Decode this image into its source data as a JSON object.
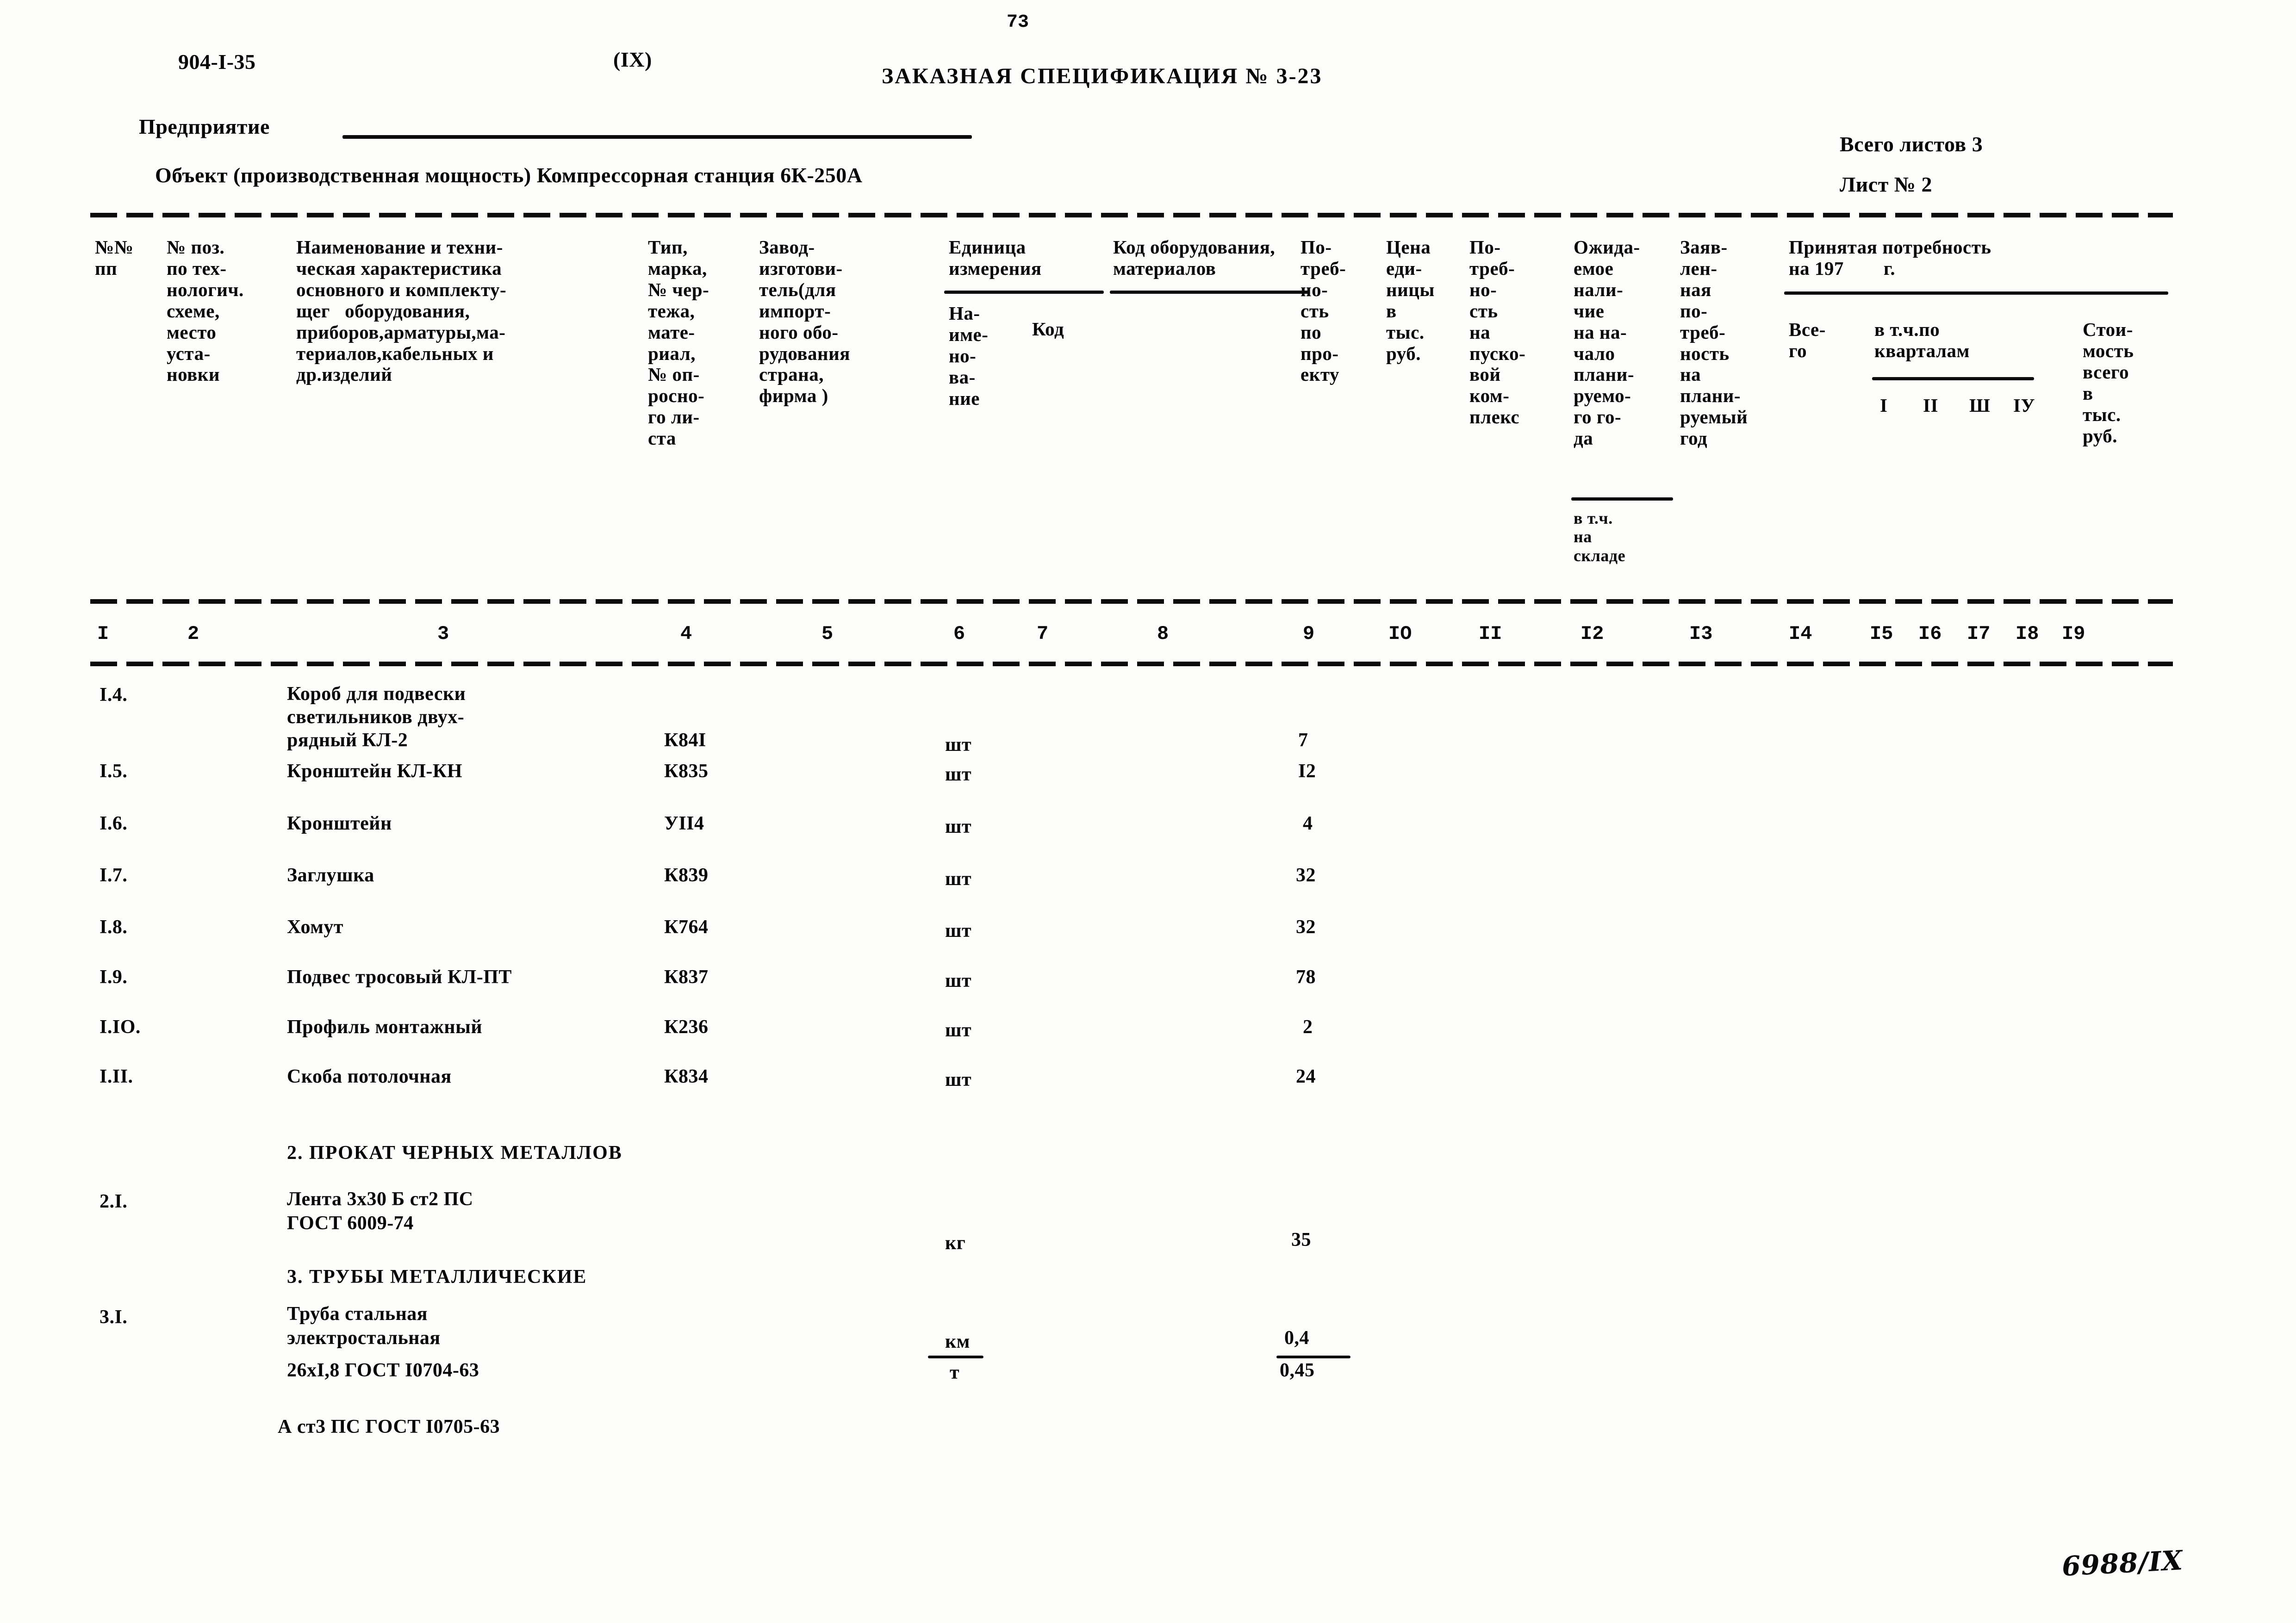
{
  "page": {
    "page_number": "73",
    "doc_code": "904-I-35",
    "section_mark": "(IX)",
    "title": "ЗАКАЗНАЯ СПЕЦИФИКАЦИЯ № 3-23",
    "enterprise_label": "Предприятие",
    "object_line": "Объект (производственная мощность) Компрессорная станция 6К-250А",
    "total_sheets": "Всего листов 3",
    "sheet_no": "Лист № 2",
    "archive_mark": "6988/IX"
  },
  "headers": {
    "col1": "№№\nпп",
    "col2": "№ поз.\nпо тех-\nнологич.\nсхеме,\nместо\nуста-\nновки",
    "col3": "Наименование и техни-\nческая характеристика\nосновного и комплекту-\nщег   оборудования,\nприборов,арматуры,ма-\nтериалов,кабельных и\nдр.изделий",
    "col4": "Тип,\nмарка,\n№ чер-\nтежа,\nмате-\nриал,\n№ оп-\nросно-\nго ли-\nста",
    "col5": "Завод-\nизготови-\nтель(для\nимпорт-\nного обо-\nрудования\nстрана,\nфирма )",
    "col6_group": "Единица\nизмерения",
    "col6": "На-\nиме-\nно-\nва-\nние",
    "col7": "Код",
    "col8": "Код оборудования,\nматериалов",
    "col9": "Потреб-\nность\nпо\nпро-\nекту",
    "col9_text": "По-\nтреб-\nно-\nсть\nпо\nпро-\nекту",
    "col10": "Цена\nеди-\nницы\nв\nтыс.\nруб.",
    "col11": "По-\nтреб-\nно-\nсть\nна\nпуско-\nвой\nком-\nплекс",
    "col12": "Ожида-\nемое\nнали-\nчие\nна на-\nчало\nплани-\nруемо-\nго го-\nда",
    "col12_sub": "в т.ч.\nна\nскладе",
    "col13": "Заяв-\nлен-\nная\nпо-\nтреб-\nность\nна\nплани-\nруемый\nгод",
    "col14_group": "Принятая потребность\nна 197        г.",
    "col14": "Все-\nго",
    "col15_group": "в т.ч.по\nкварталам",
    "quarters": [
      "I",
      "II",
      "Ш",
      "IУ"
    ],
    "col19": "Стои-\nмость\nвсего\nв\nтыс.\nруб."
  },
  "column_numbers": [
    "I",
    "2",
    "3",
    "4",
    "5",
    "6",
    "7",
    "8",
    "9",
    "IO",
    "II",
    "I2",
    "I3",
    "I4",
    "I5",
    "I6",
    "I7",
    "I8",
    "I9"
  ],
  "rows": [
    {
      "pos": "I.4.",
      "name_lines": [
        "Короб для подвески",
        "светильников двух-",
        "рядный КЛ-2"
      ],
      "type": "К84I",
      "unit": "шт",
      "qty": "7"
    },
    {
      "pos": "I.5.",
      "name_lines": [
        "Кронштейн КЛ-КН"
      ],
      "type": "К835",
      "unit": "шт",
      "qty": "I2"
    },
    {
      "pos": "I.6.",
      "name_lines": [
        "Кронштейн"
      ],
      "type": "УII4",
      "unit": "шт",
      "qty": "4"
    },
    {
      "pos": "I.7.",
      "name_lines": [
        "Заглушка"
      ],
      "type": "К839",
      "unit": "шт",
      "qty": "32"
    },
    {
      "pos": "I.8.",
      "name_lines": [
        "Хомут"
      ],
      "type": "К764",
      "unit": "шт",
      "qty": "32"
    },
    {
      "pos": "I.9.",
      "name_lines": [
        "Подвес тросовый КЛ-ПТ"
      ],
      "type": "К837",
      "unit": "шт",
      "qty": "78"
    },
    {
      "pos": "I.IO.",
      "name_lines": [
        "Профиль монтажный"
      ],
      "type": "К236",
      "unit": "шт",
      "qty": "2"
    },
    {
      "pos": "I.II.",
      "name_lines": [
        "Скоба потолочная"
      ],
      "type": "К834",
      "unit": "шт",
      "qty": "24"
    }
  ],
  "sections": [
    {
      "heading": "2. ПРОКАТ ЧЕРНЫХ МЕТАЛЛОВ"
    },
    {
      "heading": "3. ТРУБЫ МЕТАЛЛИЧЕСКИЕ"
    }
  ],
  "row_2_1": {
    "pos": "2.I.",
    "name_lines": [
      "Лента 3х30 Б ст2 ПС",
      "ГОСТ 6009-74"
    ],
    "unit": "кг",
    "qty": "35"
  },
  "row_3_1": {
    "pos": "3.I.",
    "name_lines": [
      "Труба стальная",
      "электростальная",
      "26хI,8 ГОСТ I0704-63"
    ],
    "unit_num": "км",
    "unit_den": "т",
    "qty_num": "0,4",
    "qty_den": "0,45",
    "note": "А ст3 ПС ГОСТ I0705-63"
  }
}
